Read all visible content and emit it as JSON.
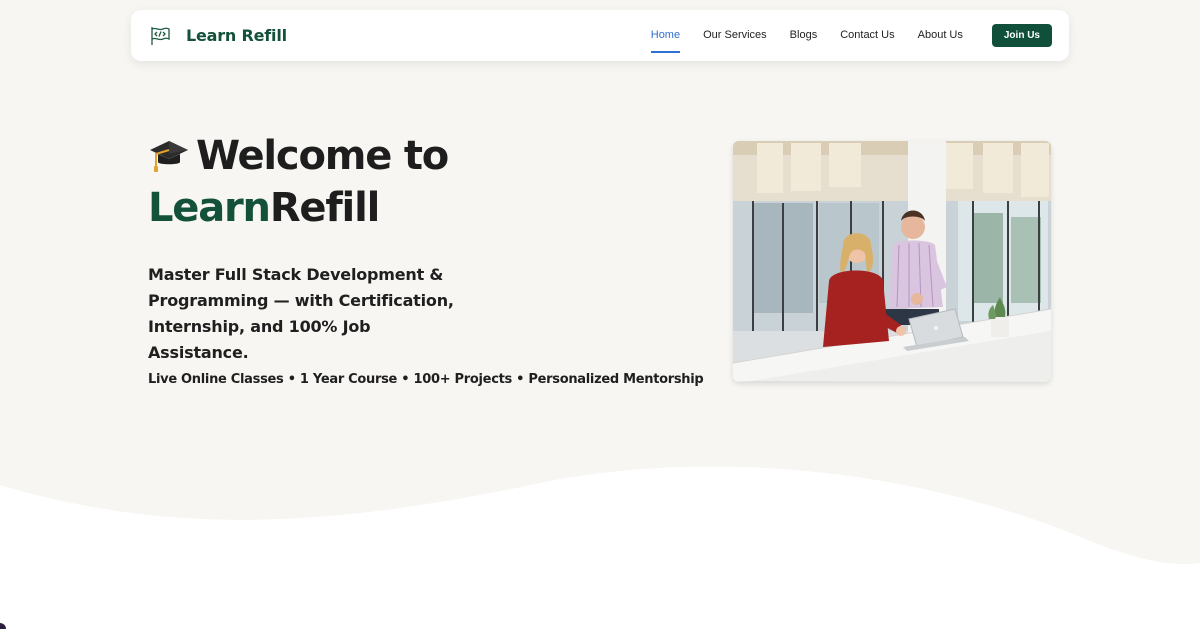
{
  "nav": {
    "brand": "Learn Refill",
    "links": [
      "Home",
      "Our Services",
      "Blogs",
      "Contact Us",
      "About Us"
    ],
    "active_link": "Home",
    "cta": "Join Us"
  },
  "hero": {
    "title_line1": "Welcome to",
    "title_green": "Learn",
    "title_dark": "Refill",
    "subtitle": "Master Full Stack Development & Programming — with Certification, Internship, and 100% Job Assistance.",
    "features": "Live Online Classes • 1 Year Course • 100+ Projects • Personalized Mentorship"
  },
  "colors": {
    "brand_green": "#13513a",
    "active_link": "#2f6fd3",
    "background": "#f7f6f2"
  },
  "icons": {
    "logo": "code-flag-icon",
    "title_emoji": "graduation-cap-icon"
  }
}
